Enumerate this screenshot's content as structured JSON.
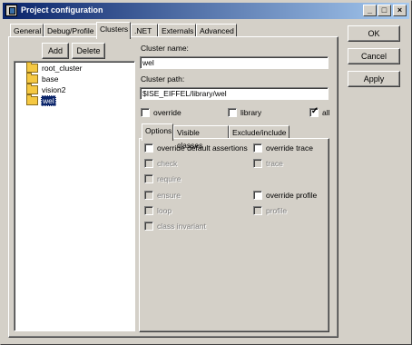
{
  "window": {
    "title": "Project configuration",
    "minimize_symbol": "_",
    "maximize_symbol": "□",
    "close_symbol": "×"
  },
  "tabs": [
    {
      "label": "General"
    },
    {
      "label": "Debug/Profile"
    },
    {
      "label": "Clusters",
      "active": true
    },
    {
      "label": ".NET"
    },
    {
      "label": "Externals"
    },
    {
      "label": "Advanced"
    }
  ],
  "dialog_buttons": {
    "ok": "OK",
    "cancel": "Cancel",
    "apply": "Apply"
  },
  "cluster_buttons": {
    "add": "Add",
    "delete": "Delete"
  },
  "tree": {
    "items": [
      {
        "label": "root_cluster",
        "icon": "folder-icon"
      },
      {
        "label": "base",
        "icon": "folder-icon"
      },
      {
        "label": "vision2",
        "icon": "folder-icon"
      },
      {
        "label": "wel",
        "icon": "folder-icon",
        "selected": true
      }
    ]
  },
  "cluster": {
    "name_label": "Cluster name:",
    "name_value": "wel",
    "path_label": "Cluster path:",
    "path_value": "$ISE_EIFFEL/library/wel"
  },
  "options_row": {
    "override": {
      "label": "override",
      "checked": false
    },
    "library": {
      "label": "library",
      "checked": false
    },
    "all": {
      "label": "all",
      "checked": true,
      "mark": "✓"
    }
  },
  "subtabs": [
    {
      "label": "Options",
      "active": true
    },
    {
      "label": "Visible classes"
    },
    {
      "label": "Exclude/include"
    }
  ],
  "options": {
    "override_default_assertions": "override default assertions",
    "check": "check",
    "require": "require",
    "ensure": "ensure",
    "loop": "loop",
    "class_invariant": "class invariant",
    "override_trace": "override trace",
    "trace": "trace",
    "override_profile": "override profile",
    "profile": "profile"
  },
  "colors": {
    "face": "#d4d0c8",
    "title_start": "#0a246a",
    "title_end": "#a6caf0",
    "selection": "#0a246a",
    "folder": "#f5c842"
  }
}
